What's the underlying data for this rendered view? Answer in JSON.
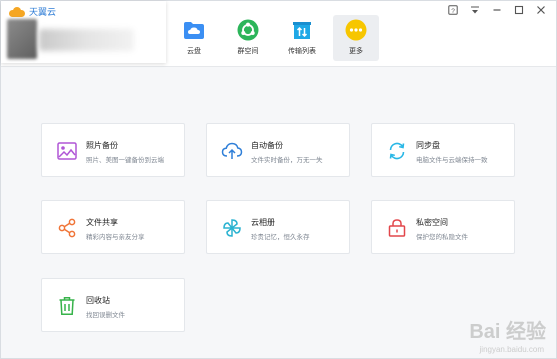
{
  "app": {
    "name": "天翼云"
  },
  "nav": [
    {
      "label": "云盘",
      "icon": "cloud-folder-icon",
      "color": "#3b8ff3"
    },
    {
      "label": "群空间",
      "icon": "group-space-icon",
      "color": "#2cb55a"
    },
    {
      "label": "传输列表",
      "icon": "transfer-list-icon",
      "color": "#1fa8e6"
    },
    {
      "label": "更多",
      "icon": "more-icon",
      "color": "#f7c600",
      "active": true
    }
  ],
  "cards": [
    {
      "title": "照片备份",
      "desc": "照片、美图一键备份到云端",
      "icon": "photo-icon",
      "color": "#b056d6"
    },
    {
      "title": "自动备份",
      "desc": "文件实时备份，万无一失",
      "icon": "cloud-upload-icon",
      "color": "#2f7fd8"
    },
    {
      "title": "同步盘",
      "desc": "电脑文件与云端保持一致",
      "icon": "sync-icon",
      "color": "#29b7e6"
    },
    {
      "title": "文件共享",
      "desc": "精彩内容与亲友分享",
      "icon": "share-icon",
      "color": "#f07437"
    },
    {
      "title": "云相册",
      "desc": "珍贵记忆，恒久永存",
      "icon": "pinwheel-icon",
      "color": "#2bb3d1"
    },
    {
      "title": "私密空间",
      "desc": "保护您的私隐文件",
      "icon": "lock-icon",
      "color": "#e2464a"
    },
    {
      "title": "回收站",
      "desc": "找回误删文件",
      "icon": "trash-icon",
      "color": "#37b34a"
    }
  ],
  "watermark": {
    "text": "Bai 经验",
    "sub": "jingyan.baidu.com"
  }
}
